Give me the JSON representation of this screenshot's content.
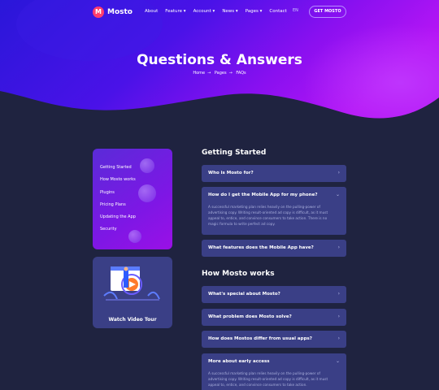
{
  "nav": {
    "logo": "Mosto",
    "items": [
      "About",
      "Feature",
      "Account",
      "News",
      "Pages",
      "Contact"
    ],
    "lang": "EN",
    "cta": "GET MOSTO"
  },
  "hero": {
    "title": "Questions & Answers",
    "breadcrumb": [
      "Home",
      "Pages",
      "FAQs"
    ]
  },
  "sidebar": {
    "items": [
      "Getting Started",
      "How Mosto works",
      "Plugins",
      "Pricing Plans",
      "Updating the App",
      "Security"
    ],
    "video_label": "Watch Video Tour"
  },
  "faq": {
    "sections": [
      {
        "title": "Getting Started",
        "questions": [
          {
            "q": "Who is Mosto for?"
          },
          {
            "q": "How do I get the Mobile App for my phone?",
            "a": "A successful marketing plan relies heavily on the pulling-power of advertising copy. Writing result-oriented ad copy is difficult, as it must appeal to, entice, and convince consumers to take action. There is no magic formula to write perfect ad copy."
          },
          {
            "q": "What features does the Mobile App have?"
          }
        ]
      },
      {
        "title": "How Mosto works",
        "questions": [
          {
            "q": "What's special about Mosto?"
          },
          {
            "q": "What problem does Mosto solve?"
          },
          {
            "q": "How does Mostos differ from usual apps?"
          },
          {
            "q": "More about early access",
            "a": "A successful marketing plan relies heavily on the pulling-power of advertising copy. Writing result-oriented ad copy is difficult, as it must appeal to, entice, and convince consumers to take action."
          }
        ]
      }
    ]
  }
}
